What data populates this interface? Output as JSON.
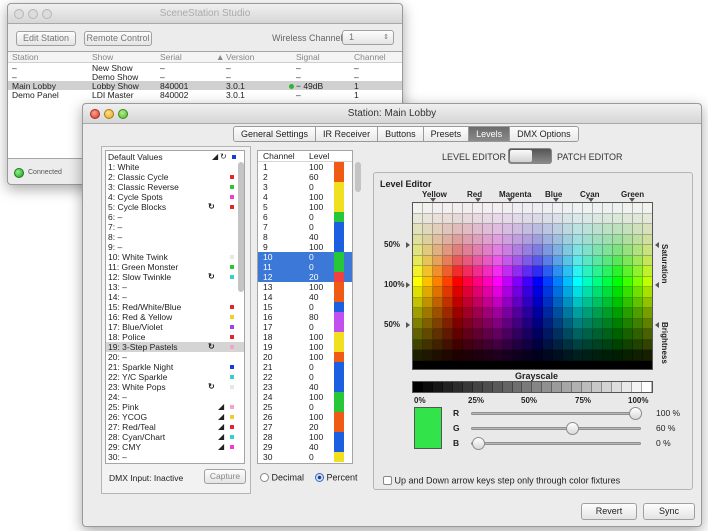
{
  "back_window": {
    "title": "SceneStation Studio",
    "edit_station": "Edit Station",
    "remote_control": "Remote Control",
    "wireless_label": "Wireless Channel:",
    "wireless_value": "1",
    "headers": [
      "Station",
      "Show",
      "Serial",
      "Version",
      "Signal",
      "Channel"
    ],
    "rows": [
      [
        "–",
        "New Show",
        "–",
        "–",
        "–",
        "–"
      ],
      [
        "–",
        "Demo Show",
        "–",
        "–",
        "–",
        "–"
      ],
      [
        "Main Lobby",
        "Lobby Show",
        "840001",
        "3.0.1",
        "− 49dB",
        "1"
      ],
      [
        "Demo Panel",
        "LDI Master",
        "840002",
        "3.0.1",
        "–",
        "1"
      ]
    ],
    "status": "Connected"
  },
  "main_window": {
    "title": "Station: Main Lobby",
    "tabs": [
      "General Settings",
      "IR Receiver",
      "Buttons",
      "Presets",
      "Levels",
      "DMX Options"
    ],
    "active_tab": "Levels",
    "preset_header": "Default Values",
    "presets": [
      "1:  White",
      "2:  Classic Cycle",
      "3:  Classic Reverse",
      "4:  Cycle Spots",
      "5:  Cycle Blocks",
      "6:  –",
      "7:  –",
      "8:  –",
      "9:  –",
      "10: White Twink",
      "11: Green Monster",
      "12: Slow Twinkle",
      "13: –",
      "14: –",
      "15: Red/White/Blue",
      "16: Red & Yellow",
      "17: Blue/Violet",
      "18: Police",
      "19: 3-Step Pastels",
      "20: –",
      "21: Sparkle Night",
      "22: Y/C Sparkle",
      "23: White Pops",
      "24: –",
      "25: Pink",
      "26: YCOG",
      "27: Red/Teal",
      "28: Cyan/Chart",
      "29: CMY",
      "30: –"
    ],
    "dmx_input": "DMX Input: Inactive",
    "capture": "Capture",
    "channel_header": "Channel",
    "level_header": "Level",
    "channels": [
      [
        "1",
        "100"
      ],
      [
        "2",
        "60"
      ],
      [
        "3",
        "0"
      ],
      [
        "4",
        "100"
      ],
      [
        "5",
        "100"
      ],
      [
        "6",
        "0"
      ],
      [
        "7",
        "0"
      ],
      [
        "8",
        "40"
      ],
      [
        "9",
        "100"
      ],
      [
        "10",
        "0"
      ],
      [
        "11",
        "0"
      ],
      [
        "12",
        "20"
      ],
      [
        "13",
        "100"
      ],
      [
        "14",
        "40"
      ],
      [
        "15",
        "0"
      ],
      [
        "16",
        "80"
      ],
      [
        "17",
        "0"
      ],
      [
        "18",
        "100"
      ],
      [
        "19",
        "100"
      ],
      [
        "20",
        "100"
      ],
      [
        "21",
        "0"
      ],
      [
        "22",
        "0"
      ],
      [
        "23",
        "40"
      ],
      [
        "24",
        "100"
      ],
      [
        "25",
        "0"
      ],
      [
        "26",
        "100"
      ],
      [
        "27",
        "20"
      ],
      [
        "28",
        "100"
      ],
      [
        "29",
        "40"
      ],
      [
        "30",
        "0"
      ]
    ],
    "decimal": "Decimal",
    "percent": "Percent",
    "level_editor_toggle": "LEVEL EDITOR",
    "patch_editor_toggle": "PATCH EDITOR",
    "level_editor_title": "Level Editor",
    "hue_labels": [
      "Yellow",
      "Red",
      "Magenta",
      "Blue",
      "Cyan",
      "Green"
    ],
    "left_marks": [
      "50%",
      "100%",
      "50%"
    ],
    "right_labels": [
      "Saturation",
      "Brightness"
    ],
    "grayscale_label": "Grayscale",
    "gray_ticks": [
      "0%",
      "25%",
      "50%",
      "75%",
      "100%"
    ],
    "rgb": [
      {
        "label": "R",
        "value": "100 %",
        "level": 1.0
      },
      {
        "label": "G",
        "value": "60 %",
        "level": 0.6
      },
      {
        "label": "B",
        "value": "0 %",
        "level": 0.0
      }
    ],
    "arrow_keys_option": "Up and Down arrow keys step only through color fixtures",
    "revert": "Revert",
    "sync": "Sync",
    "swatch_color": "#33e34a"
  }
}
